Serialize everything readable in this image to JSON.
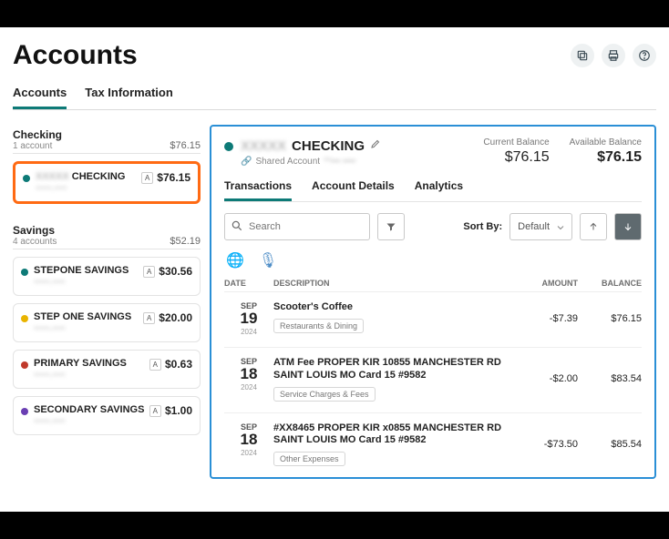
{
  "header": {
    "title": "Accounts",
    "tabs": [
      {
        "label": "Accounts",
        "active": true
      },
      {
        "label": "Tax Information",
        "active": false
      }
    ]
  },
  "sidebar": {
    "groups": [
      {
        "title": "Checking",
        "sub": "1 account",
        "total": "$76.15",
        "accounts": [
          {
            "dot": "#0d7a77",
            "name_prefix": "XXXXX",
            "name": "CHECKING",
            "mask": "*****-****",
            "badge": "A",
            "balance": "$76.15",
            "selected": true
          }
        ]
      },
      {
        "title": "Savings",
        "sub": "4 accounts",
        "total": "$52.19",
        "accounts": [
          {
            "dot": "#0d7a77",
            "name_prefix": "",
            "name": "STEPONE SAVINGS",
            "mask": "*****-****",
            "badge": "A",
            "balance": "$30.56",
            "selected": false
          },
          {
            "dot": "#e9b400",
            "name_prefix": "",
            "name": "STEP ONE SAVINGS",
            "mask": "*****-****",
            "badge": "A",
            "balance": "$20.00",
            "selected": false
          },
          {
            "dot": "#c0392b",
            "name_prefix": "",
            "name": "PRIMARY SAVINGS",
            "mask": "*****-****",
            "badge": "A",
            "balance": "$0.63",
            "selected": false
          },
          {
            "dot": "#6a3fb3",
            "name_prefix": "",
            "name": "SECONDARY SAVINGS",
            "mask": "*****-****",
            "badge": "A",
            "balance": "$1.00",
            "selected": false
          }
        ]
      }
    ]
  },
  "panel": {
    "title_prefix": "XXXXX",
    "title": "CHECKING",
    "shared_prefix": "Shared Account",
    "shared_mask": "**••• ••••",
    "current_balance_label": "Current Balance",
    "current_balance": "$76.15",
    "available_balance_label": "Available Balance",
    "available_balance": "$76.15",
    "tabs": [
      {
        "label": "Transactions",
        "active": true
      },
      {
        "label": "Account Details",
        "active": false
      },
      {
        "label": "Analytics",
        "active": false
      }
    ],
    "search_placeholder": "Search",
    "sort_label": "Sort By:",
    "sort_value": "Default",
    "columns": {
      "date": "DATE",
      "desc": "DESCRIPTION",
      "amount": "AMOUNT",
      "balance": "BALANCE"
    },
    "transactions": [
      {
        "month": "SEP",
        "day": "19",
        "year": "2024",
        "title": "Scooter's Coffee",
        "category": "Restaurants & Dining",
        "amount": "-$7.39",
        "balance": "$76.15"
      },
      {
        "month": "SEP",
        "day": "18",
        "year": "2024",
        "title": "ATM Fee PROPER KIR 10855 MANCHESTER RD SAINT LOUIS MO Card 15 #9582",
        "category": "Service Charges & Fees",
        "amount": "-$2.00",
        "balance": "$83.54"
      },
      {
        "month": "SEP",
        "day": "18",
        "year": "2024",
        "title": "#XX8465 PROPER KIR x0855 MANCHESTER RD SAINT LOUIS MO Card 15 #9582",
        "category": "Other Expenses",
        "amount": "-$73.50",
        "balance": "$85.54"
      }
    ]
  }
}
